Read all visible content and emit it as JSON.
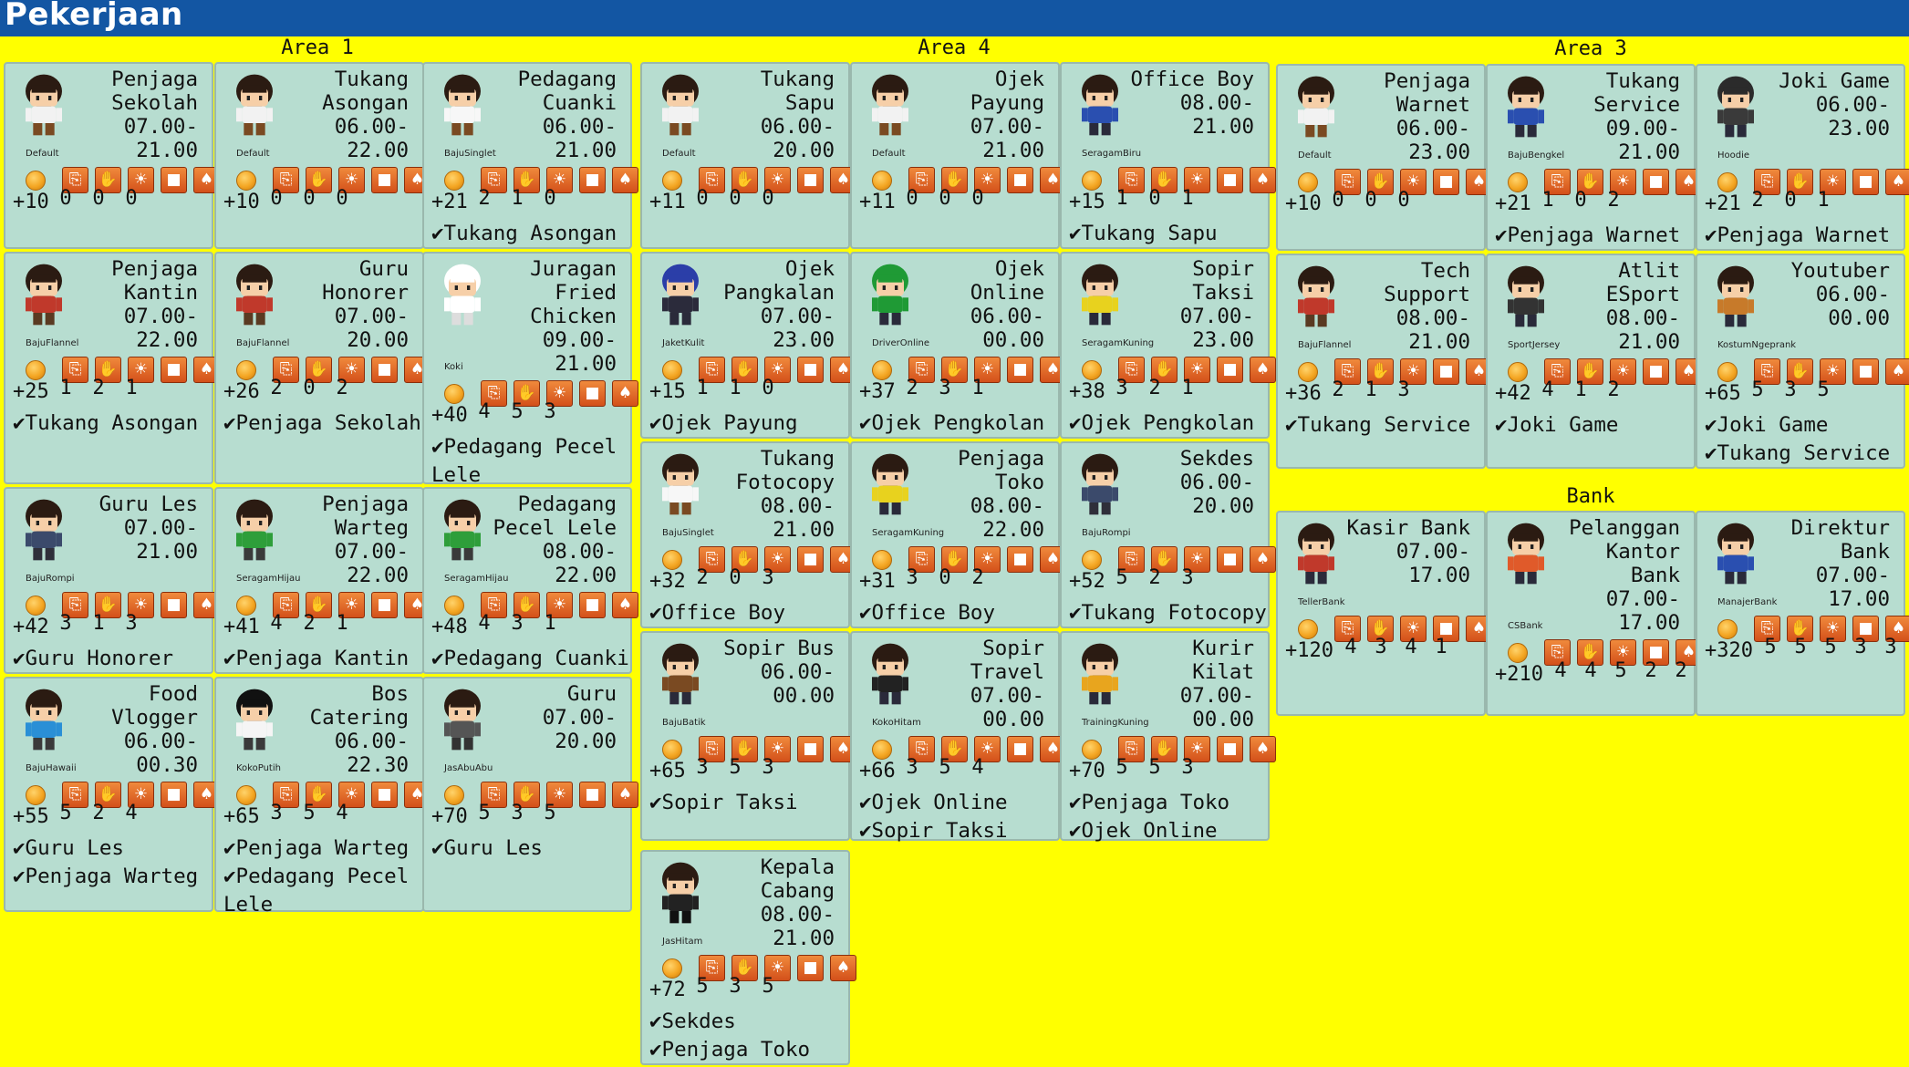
{
  "title": "Pekerjaan",
  "areas": [
    {
      "name": "Area 1",
      "cards": [
        {
          "name": "Penjaga\nSekolah",
          "hours": "07.00-\n21.00",
          "outfit": "Default",
          "salary": "+10",
          "stats": [
            "0",
            "0",
            "0"
          ],
          "reqs": [],
          "hair": "#2b1b12",
          "shirt": "#f2f2f2",
          "pants": "#7a4a22"
        },
        {
          "name": "Tukang\nAsongan",
          "hours": "06.00-\n22.00",
          "outfit": "Default",
          "salary": "+10",
          "stats": [
            "0",
            "0",
            "0"
          ],
          "reqs": [],
          "hair": "#2b1b12",
          "shirt": "#f2f2f2",
          "pants": "#7a4a22"
        },
        {
          "name": "Pedagang\nCuanki",
          "hours": "06.00-\n21.00",
          "outfit": "BajuSinglet",
          "salary": "+21",
          "stats": [
            "2",
            "1",
            "0"
          ],
          "reqs": [
            "Tukang Asongan"
          ],
          "hair": "#2b1b12",
          "shirt": "#f7f7f7",
          "pants": "#7a4a22"
        },
        {
          "name": "Penjaga\nKantin",
          "hours": "07.00-\n22.00",
          "outfit": "BajuFlannel",
          "salary": "+25",
          "stats": [
            "1",
            "2",
            "1"
          ],
          "reqs": [
            "Tukang Asongan"
          ],
          "hair": "#2b1b12",
          "shirt": "#c0392b",
          "pants": "#5a3a22"
        },
        {
          "name": "Guru\nHonorer",
          "hours": "07.00-\n20.00",
          "outfit": "BajuFlannel",
          "salary": "+26",
          "stats": [
            "2",
            "0",
            "2"
          ],
          "reqs": [
            "Penjaga Sekolah"
          ],
          "hair": "#2b1b12",
          "shirt": "#c0392b",
          "pants": "#5a3a22"
        },
        {
          "name": "Juragan\nFried\nChicken",
          "hours": "09.00-\n21.00",
          "outfit": "Koki",
          "salary": "+40",
          "stats": [
            "4",
            "5",
            "3"
          ],
          "reqs": [
            "Pedagang Pecel",
            "Lele"
          ],
          "hair": "#ffffff",
          "shirt": "#ffffff",
          "pants": "#dddddd",
          "tall": true
        },
        {
          "name": "Guru Les",
          "hours": "07.00-\n21.00",
          "outfit": "BajuRompi",
          "salary": "+42",
          "stats": [
            "3",
            "1",
            "3"
          ],
          "reqs": [
            "Guru Honorer"
          ],
          "hair": "#2b1b12",
          "shirt": "#3b4a6b",
          "pants": "#2f2f3a"
        },
        {
          "name": "Penjaga\nWarteg",
          "hours": "07.00-\n22.00",
          "outfit": "SeragamHijau",
          "salary": "+41",
          "stats": [
            "4",
            "2",
            "1"
          ],
          "reqs": [
            "Penjaga Kantin"
          ],
          "hair": "#2b1b12",
          "shirt": "#2e9e3a",
          "pants": "#3a3a3a"
        },
        {
          "name": "Pedagang\nPecel Lele",
          "hours": "08.00-\n22.00",
          "outfit": "SeragamHijau",
          "salary": "+48",
          "stats": [
            "4",
            "3",
            "1"
          ],
          "reqs": [
            "Pedagang Cuanki"
          ],
          "hair": "#2b1b12",
          "shirt": "#2e9e3a",
          "pants": "#3a3a3a"
        },
        {
          "name": "Food\nVlogger",
          "hours": "06.00-\n00.30",
          "outfit": "BajuHawaii",
          "salary": "+55",
          "stats": [
            "5",
            "2",
            "4"
          ],
          "reqs": [
            "Guru Les",
            "Penjaga Warteg"
          ],
          "hair": "#2b1b12",
          "shirt": "#2a8fd6",
          "pants": "#3a3a3a"
        },
        {
          "name": "Bos\nCatering",
          "hours": "06.00-\n22.30",
          "outfit": "KokoPutih",
          "salary": "+65",
          "stats": [
            "3",
            "5",
            "4"
          ],
          "reqs": [
            "Penjaga Warteg",
            "Pedagang Pecel",
            "Lele"
          ],
          "hair": "#111111",
          "shirt": "#f5f5f5",
          "pants": "#3a3a3a"
        },
        {
          "name": "Guru",
          "hours": "07.00-\n20.00",
          "outfit": "JasAbuAbu",
          "salary": "+70",
          "stats": [
            "5",
            "3",
            "5"
          ],
          "reqs": [
            "Guru Les"
          ],
          "hair": "#2b1b12",
          "shirt": "#555555",
          "pants": "#333333"
        }
      ]
    },
    {
      "name": "Area 4",
      "cards": [
        {
          "name": "Tukang\nSapu",
          "hours": "06.00-\n20.00",
          "outfit": "Default",
          "salary": "+11",
          "stats": [
            "0",
            "0",
            "0"
          ],
          "reqs": [],
          "hair": "#2b1b12",
          "shirt": "#f2f2f2",
          "pants": "#7a4a22"
        },
        {
          "name": "Ojek\nPayung",
          "hours": "07.00-\n21.00",
          "outfit": "Default",
          "salary": "+11",
          "stats": [
            "0",
            "0",
            "0"
          ],
          "reqs": [],
          "hair": "#2b1b12",
          "shirt": "#f2f2f2",
          "pants": "#7a4a22"
        },
        {
          "name": "Office Boy",
          "hours": "08.00-\n21.00",
          "outfit": "SeragamBiru",
          "salary": "+15",
          "stats": [
            "1",
            "0",
            "1"
          ],
          "reqs": [
            "Tukang Sapu"
          ],
          "hair": "#2b1b12",
          "shirt": "#2a4fb0",
          "pants": "#2a2a3a"
        },
        {
          "name": "Ojek\nPangkalan",
          "hours": "07.00-\n23.00",
          "outfit": "JaketKulit",
          "salary": "+15",
          "stats": [
            "1",
            "1",
            "0"
          ],
          "reqs": [
            "Ojek Payung"
          ],
          "hair": "#2b3ea8",
          "shirt": "#2b2b3b",
          "pants": "#2a2a3a"
        },
        {
          "name": "Ojek\nOnline",
          "hours": "06.00-\n00.00",
          "outfit": "DriverOnline",
          "salary": "+37",
          "stats": [
            "2",
            "3",
            "1"
          ],
          "reqs": [
            "Ojek Pengkolan"
          ],
          "hair": "#1f9a35",
          "shirt": "#1f9a35",
          "pants": "#2a2a3a"
        },
        {
          "name": "Sopir\nTaksi",
          "hours": "07.00-\n23.00",
          "outfit": "SeragamKuning",
          "salary": "+38",
          "stats": [
            "3",
            "2",
            "1"
          ],
          "reqs": [
            "Ojek Pengkolan"
          ],
          "hair": "#2b1b12",
          "shirt": "#e8d21e",
          "pants": "#2a2a3a"
        },
        {
          "name": "Tukang\nFotocopy",
          "hours": "08.00-\n21.00",
          "outfit": "BajuSinglet",
          "salary": "+32",
          "stats": [
            "2",
            "0",
            "3"
          ],
          "reqs": [
            "Office Boy"
          ],
          "hair": "#2b1b12",
          "shirt": "#f7f7f7",
          "pants": "#7a4a22"
        },
        {
          "name": "Penjaga\nToko",
          "hours": "08.00-\n22.00",
          "outfit": "SeragamKuning",
          "salary": "+31",
          "stats": [
            "3",
            "0",
            "2"
          ],
          "reqs": [
            "Office Boy"
          ],
          "hair": "#2b1b12",
          "shirt": "#e8d21e",
          "pants": "#2a2a3a"
        },
        {
          "name": "Sekdes",
          "hours": "06.00-\n20.00",
          "outfit": "BajuRompi",
          "salary": "+52",
          "stats": [
            "5",
            "2",
            "3"
          ],
          "reqs": [
            "Tukang Fotocopy"
          ],
          "hair": "#2b1b12",
          "shirt": "#3b4a6b",
          "pants": "#2f2f3a"
        },
        {
          "name": "Sopir Bus",
          "hours": "06.00-\n00.00",
          "outfit": "BajuBatik",
          "salary": "+65",
          "stats": [
            "3",
            "5",
            "3"
          ],
          "reqs": [
            "Sopir Taksi"
          ],
          "hair": "#2b1b12",
          "shirt": "#7a4a22",
          "pants": "#2a2a3a"
        },
        {
          "name": "Sopir\nTravel",
          "hours": "07.00-\n00.00",
          "outfit": "KokoHitam",
          "salary": "+66",
          "stats": [
            "3",
            "5",
            "4"
          ],
          "reqs": [
            "Ojek Online",
            "Sopir Taksi"
          ],
          "hair": "#2b1b12",
          "shirt": "#222222",
          "pants": "#2a2a3a"
        },
        {
          "name": "Kurir\nKilat",
          "hours": "07.00-\n00.00",
          "outfit": "TrainingKuning",
          "salary": "+70",
          "stats": [
            "5",
            "5",
            "3"
          ],
          "reqs": [
            "Penjaga Toko",
            "Ojek Online"
          ],
          "hair": "#2b1b12",
          "shirt": "#e8a51e",
          "pants": "#2a2a3a"
        },
        {
          "name": "Kepala\nCabang",
          "hours": "08.00-\n21.00",
          "outfit": "JasHitam",
          "salary": "+72",
          "stats": [
            "5",
            "3",
            "5"
          ],
          "reqs": [
            "Sekdes",
            "Penjaga Toko"
          ],
          "hair": "#2b1b12",
          "shirt": "#222222",
          "pants": "#111111"
        }
      ]
    },
    {
      "name": "Area 3",
      "cards": [
        {
          "name": "Penjaga\nWarnet",
          "hours": "06.00-\n23.00",
          "outfit": "Default",
          "salary": "+10",
          "stats": [
            "0",
            "0",
            "0"
          ],
          "reqs": [],
          "hair": "#2b1b12",
          "shirt": "#f2f2f2",
          "pants": "#7a4a22"
        },
        {
          "name": "Tukang\nService",
          "hours": "09.00-\n21.00",
          "outfit": "BajuBengkel",
          "salary": "+21",
          "stats": [
            "1",
            "0",
            "2"
          ],
          "reqs": [
            "Penjaga Warnet"
          ],
          "hair": "#2b1b12",
          "shirt": "#2a4fb0",
          "pants": "#2a2a3a"
        },
        {
          "name": "Joki Game",
          "hours": "06.00-\n23.00",
          "outfit": "Hoodie",
          "salary": "+21",
          "stats": [
            "2",
            "0",
            "1"
          ],
          "reqs": [
            "Penjaga Warnet"
          ],
          "hair": "#2b2b2b",
          "shirt": "#3a3a3a",
          "pants": "#2a2a3a"
        },
        {
          "name": "Tech\nSupport",
          "hours": "08.00-\n21.00",
          "outfit": "BajuFlannel",
          "salary": "+36",
          "stats": [
            "2",
            "1",
            "3"
          ],
          "reqs": [
            "Tukang Service"
          ],
          "hair": "#2b1b12",
          "shirt": "#c0392b",
          "pants": "#5a3a22"
        },
        {
          "name": "Atlit\nESport",
          "hours": "08.00-\n21.00",
          "outfit": "SportJersey",
          "salary": "+42",
          "stats": [
            "4",
            "1",
            "2"
          ],
          "reqs": [
            "Joki Game"
          ],
          "hair": "#2b1b12",
          "shirt": "#333333",
          "pants": "#2a2a3a"
        },
        {
          "name": "Youtuber",
          "hours": "06.00-\n00.00",
          "outfit": "KostumNgeprank",
          "salary": "+65",
          "stats": [
            "5",
            "3",
            "5"
          ],
          "reqs": [
            "Joki Game",
            "Tukang Service"
          ],
          "hair": "#2b1b12",
          "shirt": "#c77a2a",
          "pants": "#2a2a3a"
        }
      ]
    },
    {
      "name": "Bank",
      "cards": [
        {
          "name": "Kasir Bank",
          "hours": "07.00-\n17.00",
          "outfit": "TellerBank",
          "salary": "+120",
          "stats": [
            "4",
            "3",
            "4",
            "1"
          ],
          "reqs": [],
          "hair": "#2b1b12",
          "shirt": "#c0392b",
          "pants": "#2a2a3a"
        },
        {
          "name": "Pelanggan\nKantor\nBank",
          "hours": "07.00-\n17.00",
          "outfit": "CSBank",
          "salary": "+210",
          "stats": [
            "4",
            "4",
            "5",
            "2",
            "2"
          ],
          "reqs": [],
          "hair": "#2b1b12",
          "shirt": "#e05a2a",
          "pants": "#2a2a3a",
          "tall": true
        },
        {
          "name": "Direktur\nBank",
          "hours": "07.00-\n17.00",
          "outfit": "ManajerBank",
          "salary": "+320",
          "stats": [
            "5",
            "5",
            "5",
            "3",
            "3"
          ],
          "reqs": [],
          "hair": "#2b1b12",
          "shirt": "#2a4fb0",
          "pants": "#2a2a3a"
        }
      ]
    }
  ],
  "stat_icons": [
    "clipboard-icon",
    "hand-icon",
    "sun-icon",
    "book-icon",
    "bag-icon"
  ],
  "colors": {
    "title_bar": "#1356a3",
    "background": "#ffff00",
    "card": "#b7ddd0",
    "stat_icon": "#e06a2a",
    "coin": "#f4a623"
  }
}
